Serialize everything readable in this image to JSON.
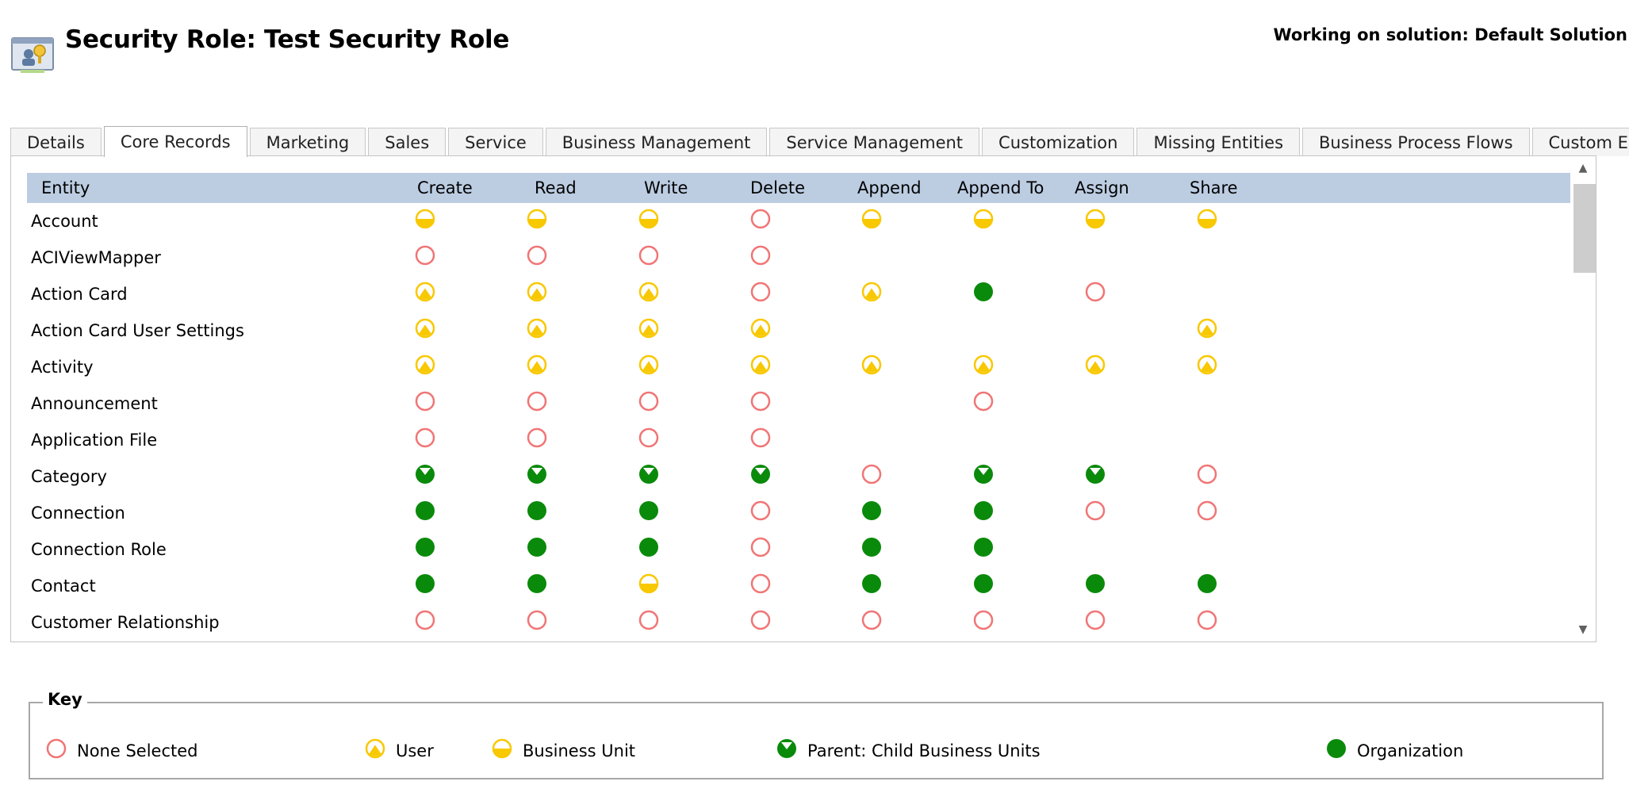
{
  "header": {
    "title": "Security Role: Test Security Role",
    "solution": "Working on solution: Default Solution",
    "icon": "security-role-icon"
  },
  "tabs": [
    {
      "label": "Details",
      "active": false
    },
    {
      "label": "Core Records",
      "active": true
    },
    {
      "label": "Marketing",
      "active": false
    },
    {
      "label": "Sales",
      "active": false
    },
    {
      "label": "Service",
      "active": false
    },
    {
      "label": "Business Management",
      "active": false
    },
    {
      "label": "Service Management",
      "active": false
    },
    {
      "label": "Customization",
      "active": false
    },
    {
      "label": "Missing Entities",
      "active": false
    },
    {
      "label": "Business Process Flows",
      "active": false
    },
    {
      "label": "Custom Entities",
      "active": false
    }
  ],
  "grid": {
    "columns": [
      "Entity",
      "Create",
      "Read",
      "Write",
      "Delete",
      "Append",
      "Append To",
      "Assign",
      "Share"
    ],
    "rows": [
      {
        "entity": "Account",
        "levels": [
          "bu",
          "bu",
          "bu",
          "none",
          "bu",
          "bu",
          "bu",
          "bu"
        ]
      },
      {
        "entity": "ACIViewMapper",
        "levels": [
          "none",
          "none",
          "none",
          "none",
          "",
          "",
          "",
          ""
        ]
      },
      {
        "entity": "Action Card",
        "levels": [
          "user",
          "user",
          "user",
          "none",
          "user",
          "org",
          "none",
          ""
        ]
      },
      {
        "entity": "Action Card User Settings",
        "levels": [
          "user",
          "user",
          "user",
          "user",
          "",
          "",
          "",
          "user"
        ]
      },
      {
        "entity": "Activity",
        "levels": [
          "user",
          "user",
          "user",
          "user",
          "user",
          "user",
          "user",
          "user"
        ]
      },
      {
        "entity": "Announcement",
        "levels": [
          "none",
          "none",
          "none",
          "none",
          "",
          "none",
          "",
          ""
        ]
      },
      {
        "entity": "Application File",
        "levels": [
          "none",
          "none",
          "none",
          "none",
          "",
          "",
          "",
          ""
        ]
      },
      {
        "entity": "Category",
        "levels": [
          "parent",
          "parent",
          "parent",
          "parent",
          "none",
          "parent",
          "parent",
          "none"
        ]
      },
      {
        "entity": "Connection",
        "levels": [
          "org",
          "org",
          "org",
          "none",
          "org",
          "org",
          "none",
          "none"
        ]
      },
      {
        "entity": "Connection Role",
        "levels": [
          "org",
          "org",
          "org",
          "none",
          "org",
          "org",
          "",
          ""
        ]
      },
      {
        "entity": "Contact",
        "levels": [
          "org",
          "org",
          "bu",
          "none",
          "org",
          "org",
          "org",
          "org"
        ]
      },
      {
        "entity": "Customer Relationship",
        "levels": [
          "none",
          "none",
          "none",
          "none",
          "none",
          "none",
          "none",
          "none"
        ]
      }
    ]
  },
  "key": {
    "title": "Key",
    "items": [
      {
        "level": "none",
        "label": "None Selected"
      },
      {
        "level": "user",
        "label": "User"
      },
      {
        "level": "bu",
        "label": "Business Unit"
      },
      {
        "level": "parent",
        "label": "Parent: Child Business Units"
      },
      {
        "level": "org",
        "label": "Organization"
      }
    ]
  },
  "colors": {
    "none": "#f07575",
    "user_bu": "#f8c800",
    "org": "#0a8a0a",
    "header_bg": "#bccde2"
  },
  "icons": {
    "none": "none-selected-icon",
    "user": "user-level-icon",
    "bu": "business-unit-level-icon",
    "parent": "parent-child-level-icon",
    "org": "organization-level-icon",
    "scroll_up": "▲",
    "scroll_down": "▼"
  }
}
